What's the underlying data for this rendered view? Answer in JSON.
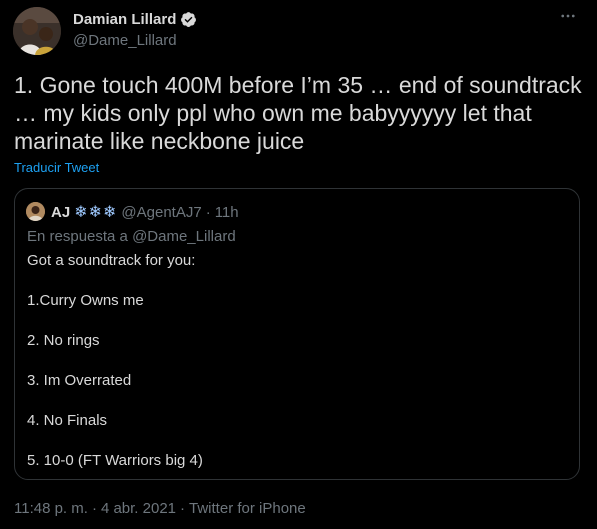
{
  "author": {
    "name": "Damian Lillard",
    "handle": "@Dame_Lillard",
    "verified": true
  },
  "tweet": {
    "text": "1. Gone touch 400M before I’m 35 … end of soundtrack … my kids only ppl who own me babyyyyyy let that marinate like neckbone juice",
    "translate_label": "Traducir Tweet"
  },
  "quoted_tweet": {
    "name": "AJ",
    "emoji": "❄❄❄",
    "handle": "@AgentAJ7",
    "separator": "·",
    "time": "11h",
    "reply_to": "En respuesta a @Dame_Lillard",
    "lines": [
      "Got a soundtrack for you:",
      "1.Curry Owns me",
      "2. No rings",
      "3. Im Overrated",
      "4. No Finals",
      "5. 10-0 (FT Warriors big 4)"
    ]
  },
  "meta": {
    "time": "11:48 p. m.",
    "separator_1": "·",
    "date": "4 abr. 2021",
    "separator_2": "·",
    "source": "Twitter for iPhone"
  },
  "colors": {
    "background": "#000000",
    "text": "#d9d9d9",
    "secondary": "#6e767d",
    "link": "#1da1f2",
    "border": "#2f3336"
  },
  "icons": {
    "more": "more-horizontal-icon",
    "verified": "verified-badge-icon"
  }
}
